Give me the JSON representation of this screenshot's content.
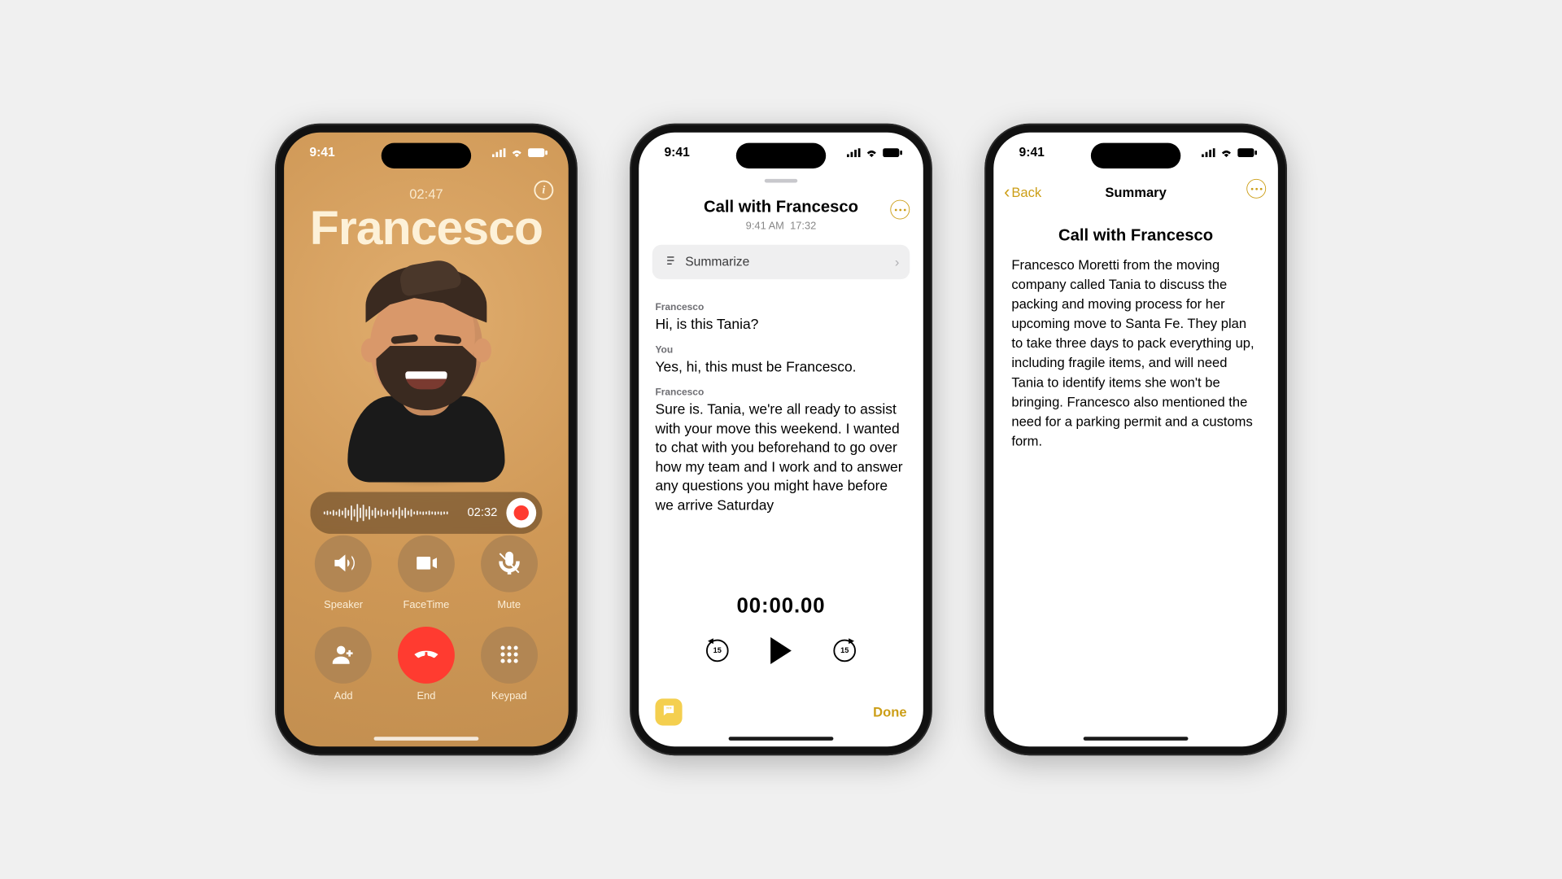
{
  "status": {
    "time": "9:41",
    "icons": {
      "signal": true,
      "wifi": true,
      "battery": true
    }
  },
  "phone1_call": {
    "duration": "02:47",
    "contact_name": "Francesco",
    "info_icon": "info-icon",
    "recording": {
      "elapsed": "02:32"
    },
    "buttons": {
      "speaker": "Speaker",
      "facetime": "FaceTime",
      "mute": "Mute",
      "add": "Add",
      "end": "End",
      "keypad": "Keypad"
    }
  },
  "phone2_transcript": {
    "title": "Call with Francesco",
    "subtitle_time": "9:41 AM",
    "subtitle_length": "17:32",
    "summarize_label": "Summarize",
    "messages": [
      {
        "speaker": "Francesco",
        "text": "Hi, is this Tania?"
      },
      {
        "speaker": "You",
        "text": "Yes, hi, this must be Francesco."
      },
      {
        "speaker": "Francesco",
        "text": "Sure is. Tania, we're all ready to assist with your move this weekend. I wanted to chat with you beforehand to go over how my team and I work and to answer any questions you might have before we arrive Saturday"
      }
    ],
    "playback_time": "00:00.00",
    "skip_seconds": "15",
    "done_label": "Done"
  },
  "phone3_summary": {
    "back_label": "Back",
    "nav_title": "Summary",
    "heading": "Call with Francesco",
    "body": "Francesco Moretti from the moving company called Tania to discuss the packing and moving process for her upcoming move to Santa Fe. They plan to take three days to pack everything up, including fragile items, and will need Tania to identify items she won't be bringing. Francesco also mentioned the need for a parking permit and a customs form."
  }
}
